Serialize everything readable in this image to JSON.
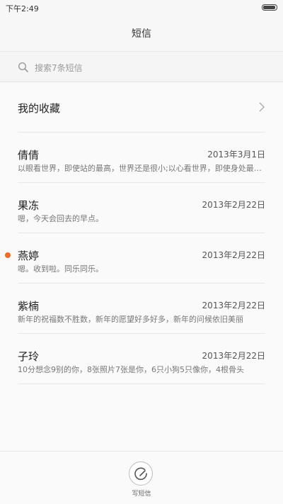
{
  "status_bar": {
    "time": "下午2:49",
    "battery_level": 1.0
  },
  "header": {
    "title": "短信"
  },
  "search": {
    "placeholder": "搜索7条短信"
  },
  "favorites": {
    "label": "我的收藏"
  },
  "conversations": [
    {
      "name": "倩倩",
      "date": "2013年3月1日",
      "snippet": "以眼看世界，即使站的最高，世界还是很小;以心看世界，即使身处最低处，世界也是大的",
      "unread": false
    },
    {
      "name": "果冻",
      "date": "2013年2月22日",
      "snippet": "嗯，今天会回去的早点。",
      "unread": false
    },
    {
      "name": "燕婷",
      "date": "2013年2月22日",
      "snippet": "嗯。收到啦。同乐同乐。",
      "unread": true
    },
    {
      "name": "紫楠",
      "date": "2013年2月22日",
      "snippet": "新年的祝福数不胜数，新年的愿望好多好多，新年的问候依旧美丽",
      "unread": false
    },
    {
      "name": "子玲",
      "date": "2013年2月22日",
      "snippet": "10分想念9别的你，8张照片7张是你，6只小狗5只像你，4根骨头",
      "unread": false
    }
  ],
  "bottom_bar": {
    "compose_label": "写短信",
    "compose_icon": "compose-icon"
  },
  "colors": {
    "unread_dot": "#f26b22",
    "background": "#fafafa"
  }
}
